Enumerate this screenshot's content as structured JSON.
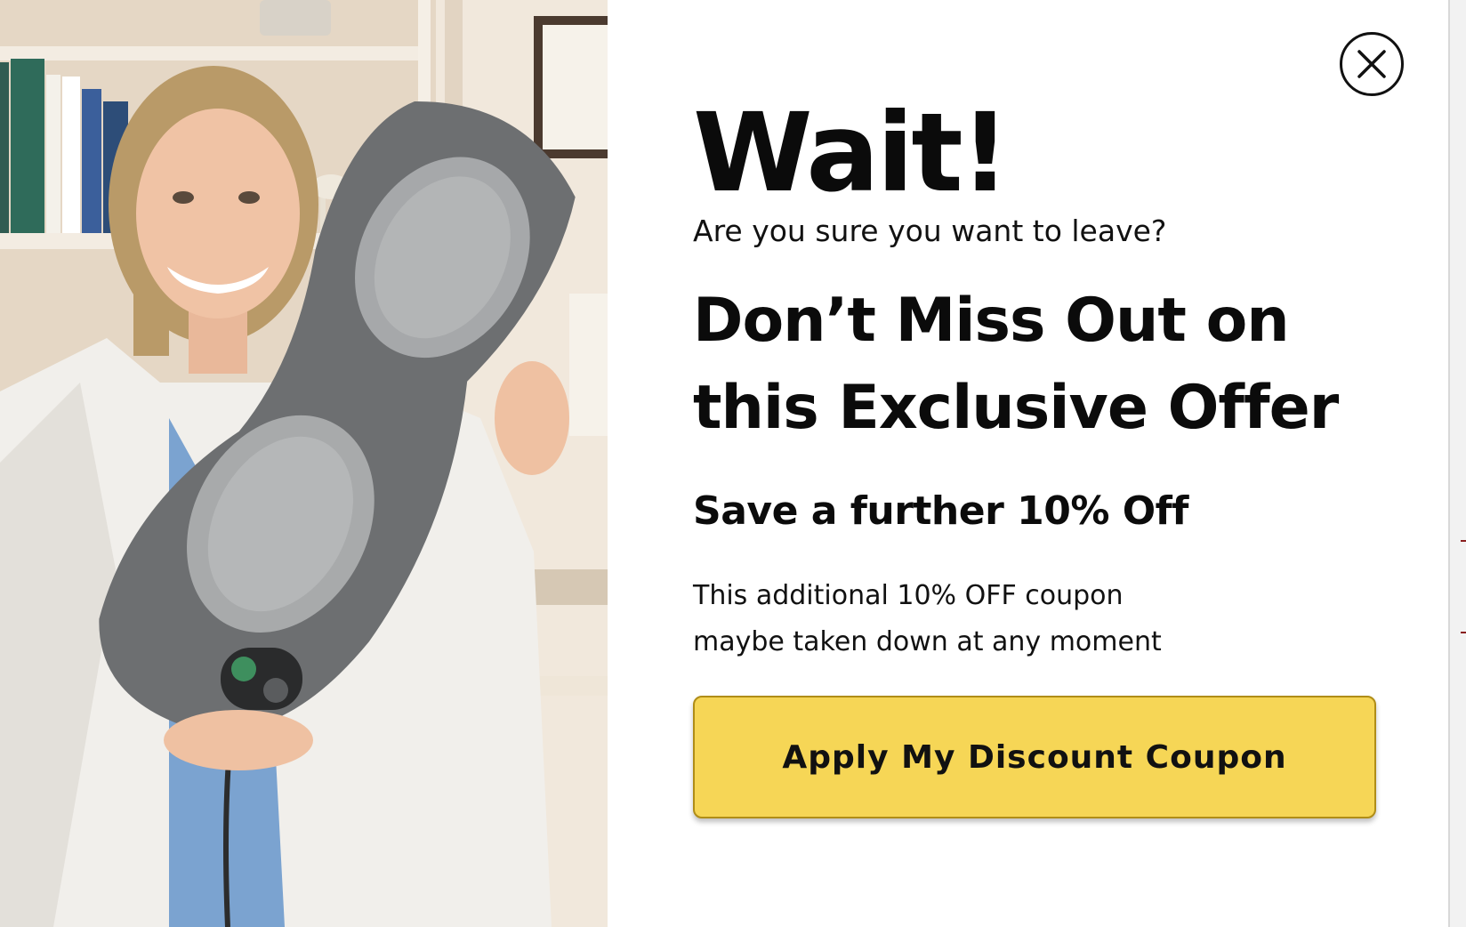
{
  "modal": {
    "close_icon": "close-icon",
    "title": "Wait!",
    "subtitle": "Are you sure you want to leave?",
    "headline_line1": "Don’t Miss Out on",
    "headline_line2": "this Exclusive Offer",
    "save_line": "Save a further 10% Off",
    "note_line1": "This additional 10% OFF coupon",
    "note_line2": "maybe taken down at any moment",
    "cta_label": "Apply My Discount Coupon"
  },
  "colors": {
    "cta_background": "#f6d656",
    "cta_border": "#b08d17",
    "text": "#0b0b0b",
    "panel": "#ffffff"
  }
}
